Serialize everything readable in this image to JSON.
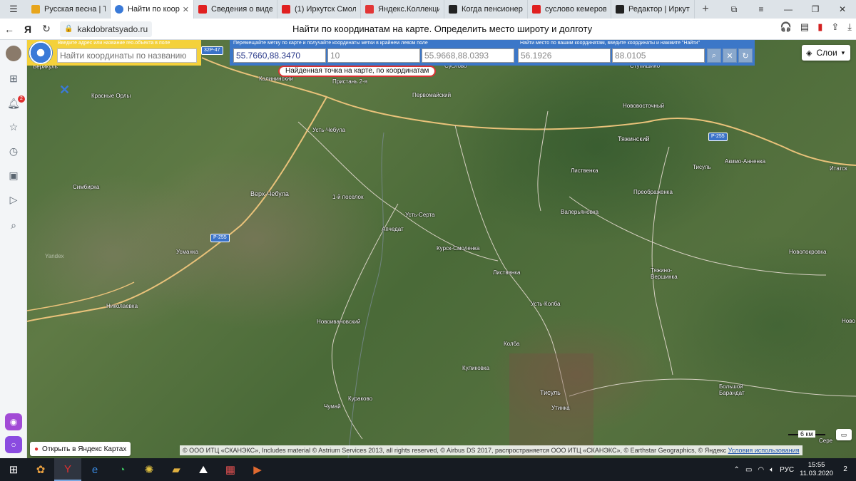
{
  "tabs": [
    {
      "label": "Русская весна | Т",
      "color": "#e7a51c",
      "active": false
    },
    {
      "label": "Найти по коор",
      "color": "#3a7ad8",
      "active": true
    },
    {
      "label": "Сведения о виде",
      "color": "#e02020",
      "active": false
    },
    {
      "label": "(1) Иркутск Смол",
      "color": "#e02020",
      "active": false
    },
    {
      "label": "Яндекс.Коллекци",
      "color": "#e23636",
      "active": false
    },
    {
      "label": "Когда пенсионер",
      "color": "#222222",
      "active": false
    },
    {
      "label": "сусловo кемеров",
      "color": "#e02020",
      "active": false
    },
    {
      "label": "Редактор | Иркут",
      "color": "#222222",
      "active": false
    }
  ],
  "address": {
    "url": "kakdobratsyado.ru",
    "page_title": "Найти по координатам на карте. Определить место широту и долготу"
  },
  "sidebar": {
    "notification_count": "2"
  },
  "search": {
    "address_hint": "Введите адрес или название гео.объекта в поле",
    "address_placeholder": "Найти координаты по названию",
    "move_hint": "Перемещайте метку по карте и получайте координаты метки в крайнем левом поле",
    "coords_value": "55.7660,88.3470",
    "zoom_value": "10",
    "center_value": "55.9668,88.0393",
    "find_hint": "Найти место по вашим координатам, введите координаты и нажмите \"Найти\"",
    "lat_value": "56.1926",
    "lon_value": "88.0105"
  },
  "map": {
    "layers_label": "Слои",
    "callout_text": "Найденная точка на карте, по координатам",
    "open_in_yandex": "Открыть в Яндекс Картах",
    "copyright": "© ООО ИТЦ «СКАНЭКС», Includes material © Astrium Services 2013, all rights reserved, © Airbus DS 2017, распространяется ООО ИТЦ «СКАНЭКС», © Earthstar Geographics, © Яндекс",
    "terms": "Условия использования",
    "scale_label": "6 км",
    "roads": [
      "32Р-47",
      "Р-255",
      "Р-255"
    ],
    "places": [
      "Берикуль",
      "Калининский",
      "Пристань 2-я",
      "Суслово",
      "Ступишино",
      "Красные Орлы",
      "Первомайский",
      "Нововосточный",
      "Усть-Чебула",
      "Тяжинский",
      "Лиственка",
      "Тисуль",
      "Акимо-Анненка",
      "Итатск",
      "Симбирка",
      "Верх-Чебула",
      "1-й поселок",
      "Преображенка",
      "Валерьяновка",
      "Усть-Серта",
      "Апчедат",
      "Усманка",
      "Курск-Смоленка",
      "Новопокровка",
      "Листвянка",
      "Тяжино-Вершинка",
      "Николаевка",
      "Усть-Колба",
      "Новоивановский",
      "Ново",
      "Колба",
      "Куликовка",
      "Тисуль",
      "Большой Барандат",
      "Утинка",
      "Кураково",
      "Чумай",
      "Сере"
    ],
    "watermark": "Yandex"
  },
  "taskbar": {
    "lang": "РУС",
    "time": "15:55",
    "date": "11.03.2020",
    "notifications": "2"
  }
}
